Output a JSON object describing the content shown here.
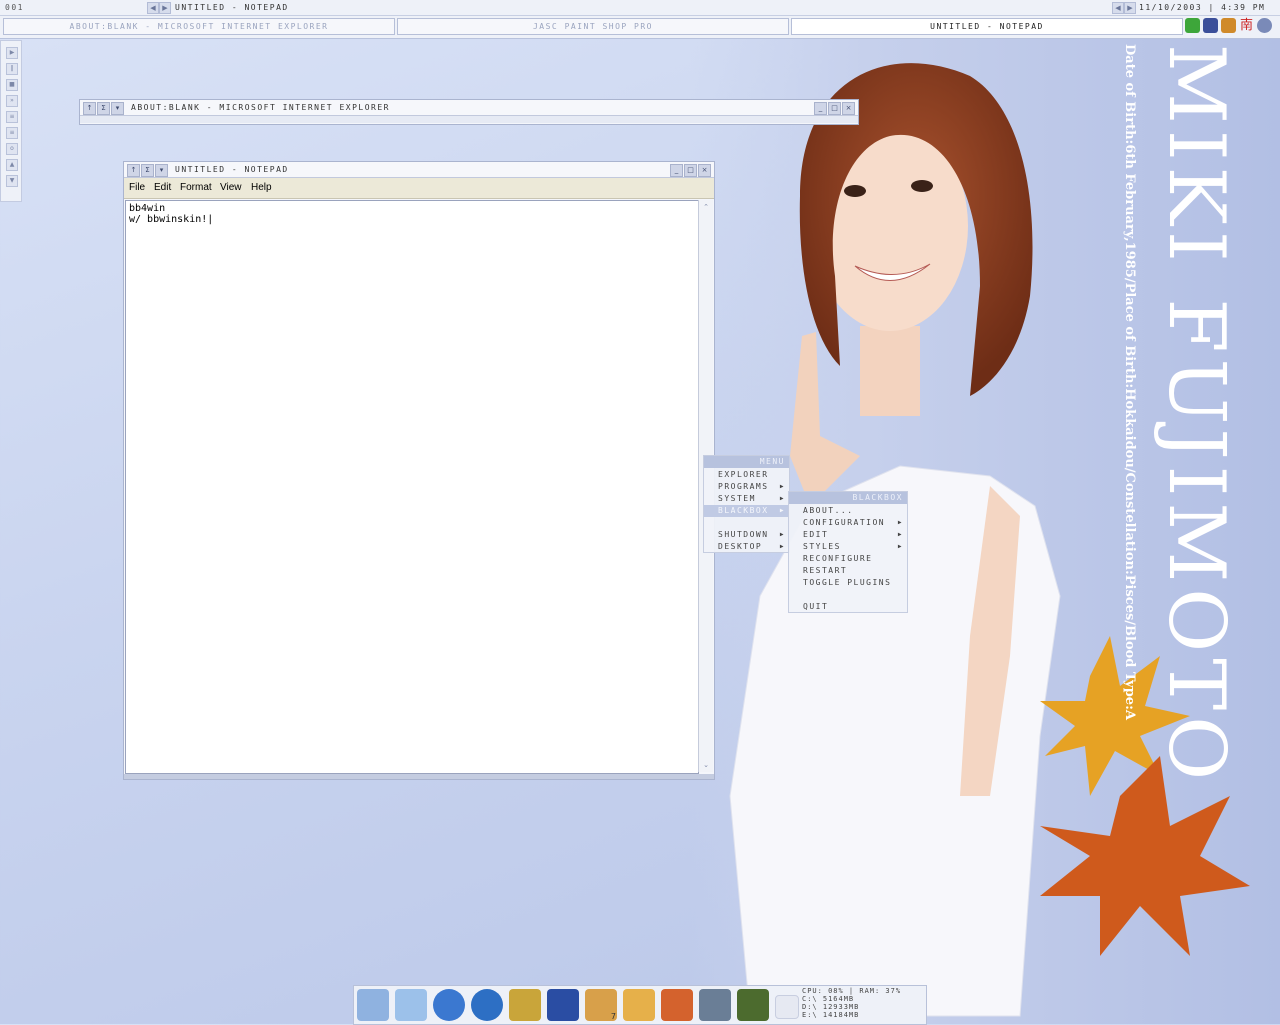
{
  "toolbar": {
    "workspace_label": "001",
    "current_window_title": "UNTITLED - NOTEPAD",
    "clock": "11/10/2003 | 4:39 PM",
    "tasks": [
      {
        "label": "ABOUT:BLANK - MICROSOFT INTERNET EXPLORER",
        "active": false
      },
      {
        "label": "JASC PAINT SHOP PRO",
        "active": false
      },
      {
        "label": "UNTITLED - NOTEPAD",
        "active": true
      }
    ],
    "tray_icons": [
      "green-app-icon",
      "monitor-icon",
      "pencil-icon",
      "chinese-char-icon",
      "globe-icon"
    ],
    "tray_char": "南"
  },
  "slit": {
    "icons": [
      "play-icon",
      "pause-icon",
      "stop-icon",
      "next-icon",
      "volume-icon",
      "eject-icon",
      "repeat-icon",
      "up-icon",
      "down-icon"
    ]
  },
  "ie_window": {
    "title": "ABOUT:BLANK - MICROSOFT INTERNET EXPLORER"
  },
  "notepad": {
    "title": "UNTITLED - NOTEPAD",
    "menus": [
      "File",
      "Edit",
      "Format",
      "View",
      "Help"
    ],
    "content": "bb4win\nw/ bbwinskin!|"
  },
  "root_menu": {
    "header": "MENU",
    "items": [
      {
        "label": "EXPLORER",
        "submenu": false,
        "highlight": false
      },
      {
        "label": "PROGRAMS",
        "submenu": true,
        "highlight": false
      },
      {
        "label": "SYSTEM",
        "submenu": true,
        "highlight": false
      },
      {
        "label": "BLACKBOX",
        "submenu": true,
        "highlight": true
      },
      {
        "label": "",
        "submenu": false,
        "highlight": false
      },
      {
        "label": "SHUTDOWN",
        "submenu": true,
        "highlight": false
      },
      {
        "label": "DESKTOP",
        "submenu": true,
        "highlight": false
      }
    ]
  },
  "blackbox_menu": {
    "header": "BLACKBOX",
    "items": [
      {
        "label": "ABOUT...",
        "submenu": false
      },
      {
        "label": "CONFIGURATION",
        "submenu": true
      },
      {
        "label": "EDIT",
        "submenu": true
      },
      {
        "label": "STYLES",
        "submenu": true
      },
      {
        "label": "RECONFIGURE",
        "submenu": false
      },
      {
        "label": "RESTART",
        "submenu": false
      },
      {
        "label": "TOGGLE PLUGINS",
        "submenu": false
      },
      {
        "label": "",
        "submenu": false
      },
      {
        "label": "QUIT",
        "submenu": false
      }
    ]
  },
  "wallpaper": {
    "name_text": "MIKI FUJIMOTO",
    "info_text": "Date of Birth:6th February,1985/Place of Birth:Hokkaidou/Constellation:Pisces/Blood Type:A"
  },
  "dock": {
    "icons": [
      "my-computer-icon",
      "notepad-icon",
      "internet-explorer-icon",
      "maxthon-icon",
      "winamp-icon",
      "word-icon",
      "paint-icon",
      "messenger-icon",
      "firewall-icon",
      "counter-strike-icon",
      "game-icon",
      "blank-icon"
    ],
    "badge": "7"
  },
  "sysmon": {
    "line1": "CPU: 08% | RAM: 37%",
    "line2": "C:\\ 5164MB",
    "line3": "D:\\ 12933MB",
    "line4": "E:\\ 14184MB"
  }
}
